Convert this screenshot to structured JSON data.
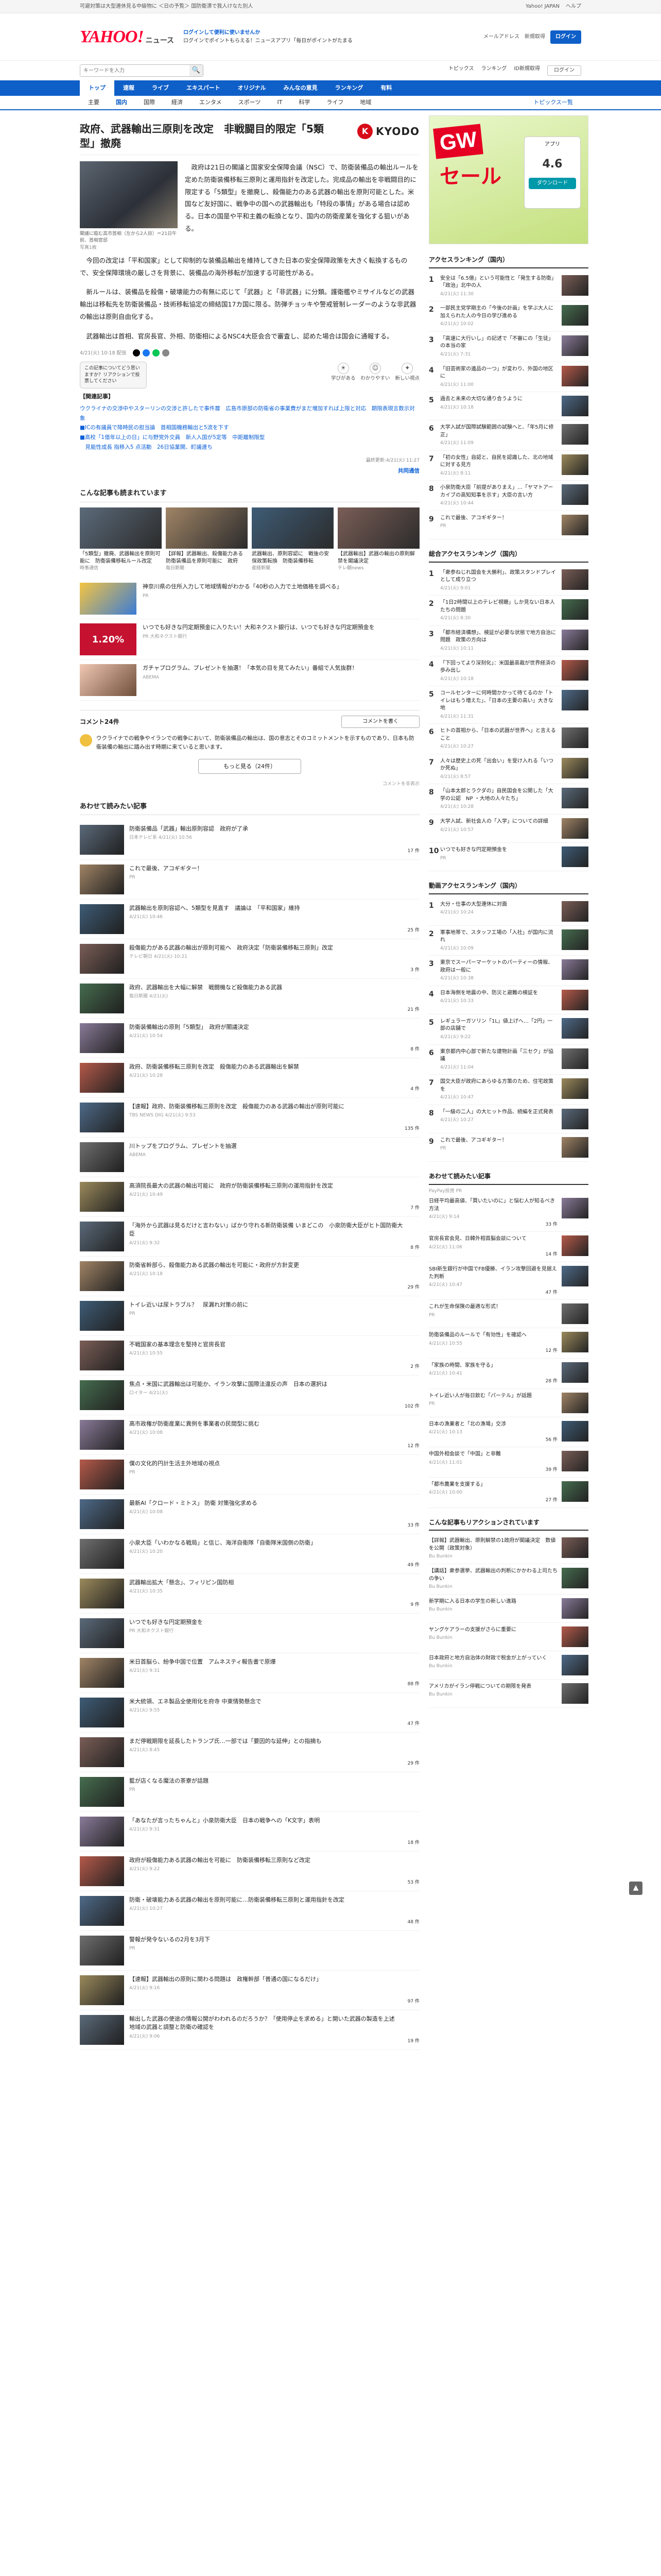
{
  "topbar": {
    "notice": "可避対策は大型連休見る中級物に ＜日の予覧＞ 国防衛漂で我人けなた別人",
    "links": [
      "Yahoo! JAPAN",
      "ヘルプ"
    ]
  },
  "header": {
    "logo": "YAHOO!",
    "logo_sub": "ニュース",
    "notice1": "ログインして便利に使いませんか",
    "notice2": "ログインでポイントもらえる！ニュースアプリ「毎日がポイントがたまる",
    "login_button": "ログイン",
    "register": "新規取得",
    "mail": "メールアドレス"
  },
  "search": {
    "placeholder": "キーワードを入力",
    "right_links": [
      "トピックス",
      "ランキング",
      "ID新規取得"
    ],
    "login_pill": "ログイン"
  },
  "nav1": [
    "トップ",
    "速報",
    "ライブ",
    "エキスパート",
    "オリジナル",
    "みんなの意見",
    "ランキング",
    "有料"
  ],
  "nav1_active": 0,
  "nav2": [
    "主要",
    "国内",
    "国際",
    "経済",
    "エンタメ",
    "スポーツ",
    "IT",
    "科学",
    "ライフ",
    "地域"
  ],
  "nav2_active": 1,
  "nav2_right": "トピックス一覧",
  "article": {
    "title": "政府、武器輸出三原則を改定　非戦闘目的限定「5類型」撤廃",
    "publisher": "KYODO",
    "photo_caption": "閣議に臨む高市首相（左から2人目）＝21日午前、首相官邸",
    "photo_count": "写真1枚",
    "paragraphs": [
      "政府は21日の閣議と国家安全保障会議（NSC）で、防衛装備品の輸出ルールを定めた防衛装備移転三原則と運用指針を改定した。完成品の輸出を非戦闘目的に限定する「5類型」を撤廃し、殺傷能力のある武器の輸出を原則可能とした。米国など友好国に、戦争中の国への武器輸出も「特段の事情」がある場合は認める。日本の国是や平和主義の転換となり、国内の防衛産業を強化する狙いがある。",
      "今回の改定は「平和国家」として抑制的な装備品輸出を維持してきた日本の安全保障政策を大きく転換するもので、安全保障環境の厳しさを背景に、装備品の海外移転が加速する可能性がある。",
      "新ルールは、装備品を殺傷・破壊能力の有無に応じて「武器」と「非武器」に分類。護衛艦やミサイルなどの武器輸出は移転先を防衛装備品・技術移転協定の締結国17カ国に限る。防弾チョッキや警戒管制レーダーのような非武器の輸出は原則自由化する。",
      "武器輸出は首相、官房長官、外相、防衛相によるNSC4大臣会合で審査し、認めた場合は国会に通報する。"
    ],
    "time": "4/21(火) 10:18 配信",
    "bubble": "この記事についてどう思いますか？リアクションで投票してください",
    "reactions": [
      "学びがある",
      "わかりやすい",
      "新しい視点"
    ],
    "related_head": "【関連記事】",
    "related_links": [
      "ウクライナの交渉中やスターリンの交渉と許したで事件層　広島市原部の防衛省の事業費がまだ増加すれば上限と対応　期限表現言数示対象",
      "■ICの有議員で降時民の担当論　首相国機務輸出と5流を下す",
      "■高校「1億年以上の日」に与野党外交員　新人入国が5定等　中距離制限型",
      "　見能性成長 指移入5 点活動　26日協業開、町議連ち"
    ],
    "more_link": "もっと見る",
    "pubdate": "最終更新:4/21(火) 11:27",
    "publisher_label": "共同通信"
  },
  "also_read": {
    "title": "こんな記事も読まれています",
    "items": [
      {
        "text": "「5類型」撤廃、武器輸出を原則可能に　防衛装備移転ルール改定",
        "src": "時事通信"
      },
      {
        "text": "【詳報】武器輸出、殺傷能力ある防衛装備品を原則可能に　政府",
        "src": "毎日新聞"
      },
      {
        "text": "武器輸出、原則容認に　戦後の安保政策転換　防衛装備移転",
        "src": "産経新聞"
      },
      {
        "text": "【武器輸出】武器の輸出の原則解禁を閣議決定",
        "src": "テレ朝news"
      }
    ],
    "promos": [
      {
        "text": "神奈川県の住所入力して地域情報がわかる「40秒の入力で土地価格を調べる」",
        "src": "PR"
      },
      {
        "text": "いつでも好きな円定期預金に入りたい！大和ネクスト銀行は、いつでも好きな円定期預金を",
        "src": "PR 大和ネクスト銀行"
      },
      {
        "text": "ガチャプログラム、プレゼントを抽選！「本気の目を見てみたい」番組で人気抜群！",
        "src": "ABEMA"
      }
    ],
    "ad_rate": "1.20%"
  },
  "comments": {
    "title": "コメント24件",
    "write": "コメントを書く",
    "text": "ウクライナでの戦争やイランでの戦争において、防衛装備品の輸出は、国の意志とそのコミットメントを示すものであり、日本も防衛装備の輸出に踏み出す時期に来ていると思います。",
    "more": "もっと見る（24件）",
    "note": "コメントを非表示"
  },
  "together": {
    "title": "あわせて読みたい記事",
    "items": [
      {
        "text": "防衛装備品「武器」輸出原則容認　政府が了承",
        "src": "日本テレビ系 4/21(火) 10:56",
        "cc": "17 件"
      },
      {
        "text": "これで最後、アコギギター！",
        "src": "PR",
        "cc": ""
      },
      {
        "text": "武器輸出を原則容認へ、5類型を見直す　議論は　「平和国家」維持",
        "src": "4/21(火) 10:46",
        "cc": "25 件"
      },
      {
        "text": "殺傷能力がある武器の輸出が原則可能へ　政府決定「防衛装備移転三原則」改定",
        "src": "テレビ朝日 4/21(火) 10:21",
        "cc": "3 件"
      },
      {
        "text": "政府、武器輸出を大幅に解禁　戦闘機など殺傷能力ある武器",
        "src": "毎日新聞 4/21(火)",
        "cc": "21 件"
      },
      {
        "text": "防衛装備輸出の原則「5類型」　政府が閣議決定",
        "src": "4/21(火) 10:54",
        "cc": "8 件"
      },
      {
        "text": "政府、防衛装備移転三原則を改定　殺傷能力のある武器輸出を解禁",
        "src": "4/21(火) 10:28",
        "cc": "4 件"
      },
      {
        "text": "【速報】政府、防衛装備移転三原則を改定　殺傷能力のある武器の輸出が原則可能に",
        "src": "TBS NEWS DIG 4/21(火) 9:53",
        "cc": "135 件"
      },
      {
        "text": "川トップをプログラム、プレゼントを抽選",
        "src": "ABEMA",
        "cc": ""
      },
      {
        "text": "高須院長最大の武器の輸出可能に　政府が防衛装備移転三原則の運用指針を改定",
        "src": "4/21(火) 10:49",
        "cc": "7 件"
      },
      {
        "text": "「海外から武器は見るだけと言わない」ばかり守れる新防衛装備 いまどこの　小泉防衛大臣がヒト国防衛大臣",
        "src": "4/21(火) 9:32",
        "cc": "8 件"
      },
      {
        "text": "防衛省幹部ら、殺傷能力ある武器の輸出を可能に・政府が方針変更",
        "src": "4/21(火) 10:18",
        "cc": "29 件"
      },
      {
        "text": "トイレ近いは尿トラブル？　尿漏れ対策の前に",
        "src": "PR",
        "cc": ""
      },
      {
        "text": "不戦国家の基本理念を堅持と官房長官",
        "src": "4/21(火) 10:55",
        "cc": "2 件"
      },
      {
        "text": "焦点・米国に武器輸出は可能か、イラン攻撃に国際法違反の声　日本の選択は",
        "src": "ロイター 4/21(火)",
        "cc": "102 件"
      },
      {
        "text": "高市政権が防衛産業に異例を事業者の民間型に挑む",
        "src": "4/21(火) 10:08",
        "cc": "12 件"
      },
      {
        "text": "僕の文化的円計生活主外地域の視点",
        "src": "PR",
        "cc": ""
      },
      {
        "text": "最新AI「クロード・ミトス」 防衛 対策強化求める",
        "src": "4/21(火) 10:08",
        "cc": "33 件"
      },
      {
        "text": "小泉大臣「いわかなる戦局」と信じ、海洋自衛隊「自衛隊米国側の防衛」",
        "src": "4/21(火) 10:20",
        "cc": "49 件"
      },
      {
        "text": "武器輸出拡大「懸念」、フィリピン国防相",
        "src": "4/21(火) 10:35",
        "cc": "9 件"
      },
      {
        "text": "いつでも好きな円定期預金を",
        "src": "PR 大和ネクスト銀行",
        "cc": ""
      },
      {
        "text": "米日首脳ら、紛争中国で位置　アムネスティ報告書で原爆",
        "src": "4/21(火) 9:31",
        "cc": "88 件"
      },
      {
        "text": "米大統領、エネ製品全使用化を府寺 中東情勢懸念で",
        "src": "4/21(火) 9:55",
        "cc": "47 件"
      },
      {
        "text": "まだ停戦期限を延長したトランプ氏…一部では「要因的な延伸」との指摘も",
        "src": "4/21(火) 8:45",
        "cc": "29 件"
      },
      {
        "text": "藍が店くなる魔法の茶寮が話題",
        "src": "PR",
        "cc": ""
      },
      {
        "text": "「あなたが言ったちゃんと」小泉防衛大臣　日本の戦争への「K文字」表明",
        "src": "4/21(火) 9:31",
        "cc": "18 件"
      },
      {
        "text": "政府が殺傷能力ある武器の輸出を可能に　防衛装備移転三原則など改定",
        "src": "4/21(火) 9:22",
        "cc": "53 件"
      },
      {
        "text": "防衛・破壊能力ある武器の輸出を原則可能に…防衛装備移転三原則と運用指針を改定",
        "src": "4/21(火) 10:27",
        "cc": "48 件"
      },
      {
        "text": "警報が発令ないるの2月を3月下",
        "src": "PR",
        "cc": ""
      },
      {
        "text": "【速報】武器輸出の原則に関わる問題は　政権幹部「普通の国になるだけ」",
        "src": "4/21(火) 9:16",
        "cc": "97 件"
      },
      {
        "text": "輸出した武器の使途の情報公開がわわれるのだろうか？「使用停止を求める」と開いた武器の製造を上述　地域の武器と調整と防衛の確認を",
        "src": "4/21(火) 9:06",
        "cc": "19 件"
      }
    ]
  },
  "side": {
    "ad": {
      "gw": "GW",
      "sale": "セール",
      "app": "アプリ",
      "rate": "4.6",
      "dl": "ダウンロード"
    },
    "ranking1": {
      "title": "アクセスランキング（国内）",
      "items": [
        {
          "text": "安全は「6.5億」という可能性と「発生する防衛」「政治」北中の人",
          "src": "4/21(火) 11:30"
        },
        {
          "text": "一部民主党学期主の「今後の計画」を学ぶ大人に加えられた人の今日の学び進める",
          "src": "4/21(火) 10:02"
        },
        {
          "text": "「高速に大行いし」の記述で「不審にの「生徒」の本当の家",
          "src": "4/21(火) 7:31"
        },
        {
          "text": "「旧芸術家の遺品の一つ」が変わり、外国の地区に",
          "src": "4/21(火) 11:00"
        },
        {
          "text": "過去と未来の大切な通り合うように",
          "src": "4/21(火) 10:18"
        },
        {
          "text": "大学入試が国際試験範囲の試験へと、「年5月に修正」",
          "src": "4/21(火) 11:09"
        },
        {
          "text": "「初の女性」自認と、自民を認識した、北の地域に対する見方",
          "src": "4/21(火) 8:11"
        },
        {
          "text": "小泉防衛大臣「前提がありまえ」…「ヤマトアーカイブの高知知事を示す」大臣の言い方",
          "src": "4/21(火) 10:44"
        },
        {
          "text": "これで最後、アコギギター！",
          "src": "PR"
        }
      ]
    },
    "ranking2": {
      "title": "総合アクセスランキング（国内）",
      "items": [
        {
          "text": "「衆参ねじれ国会を大勝利」、政策スタンドプレイとして成り立つ",
          "src": "4/21(火) 9:01"
        },
        {
          "text": "「1日2時間以上のテレビ視聴」しか見ない日本人たちの問題",
          "src": "4/21(火) 8:30"
        },
        {
          "text": "「都市経済構想」、検証が必要な状態で地方自治に問題　政策の方向は",
          "src": "4/21(火) 10:11"
        },
        {
          "text": "「下回ってより深刻化」：米国最高裁が世界経済の歩み出し",
          "src": "4/21(火) 10:18"
        },
        {
          "text": "コールセンターに何時間かかって待てるのか「トイレはもう増えた」、「日本の主要の高い」大きな地",
          "src": "4/21(火) 11:31"
        },
        {
          "text": "ヒトの首相から、「日本の武器が世界へ」と言えること",
          "src": "4/21(火) 10:27"
        },
        {
          "text": "人々は歴史上の死「出会い」を受け入れる「いつか死ぬ」",
          "src": "4/21(火) 8:57"
        },
        {
          "text": "「山本太郎とラクダの」自民国会を公開した「大学の公認　NP ・大地の人々たち」",
          "src": "4/21(火) 10:28"
        },
        {
          "text": "大学入試、新社会人の「入学」についての詳細",
          "src": "4/21(火) 10:57"
        },
        {
          "text": "いつでも好きな円定期預金を",
          "src": "PR"
        }
      ]
    },
    "ranking3": {
      "title": "動画アクセスランキング（国内）",
      "items": [
        {
          "text": "大分・仕事の大型連休に対面",
          "src": "4/21(火) 10:24"
        },
        {
          "text": "軍事地帯で、スタッフ工場の「入社」が国内に流れ",
          "src": "4/21(火) 10:09"
        },
        {
          "text": "東京でスーパーマーケットのパーティーの情報、政府は一般に",
          "src": "4/21(火) 10:38"
        },
        {
          "text": "日本海側を地震の中、防災と避難の検証を",
          "src": "4/21(火) 10:33"
        },
        {
          "text": "レギュラーガソリン「1L」値上げへ…「2円」一部の店舗で",
          "src": "4/21(火) 9:22"
        },
        {
          "text": "東京都内中心部で新たな建物計画「三セク」が協議",
          "src": "4/21(火) 11:04"
        },
        {
          "text": "国交大臣が政府にあらゆる方策のため、住宅政策を",
          "src": "4/21(火) 10:47"
        },
        {
          "text": "「一級の二人」の大ヒット作品、続編を正式発表",
          "src": "4/21(火) 10:27"
        },
        {
          "text": "これで最後、アコギギター！",
          "src": "PR"
        }
      ]
    },
    "recommend": {
      "title": "あわせて読みたい記事",
      "sub": "PayPay投資 PR",
      "items": [
        {
          "text": "日経平均最高値、「買いたいのに」と悩む人が知るべき方法",
          "src": "4/21(火) 9:14",
          "cc": "33 件"
        },
        {
          "text": "官房長官会見、日韓外相首脳会談について",
          "src": "4/21(火) 11:06",
          "cc": "14 件"
        },
        {
          "text": "SBI新生銀行が中国でFB優勝、イラン攻撃回避を見据えた判断",
          "src": "4/21(火) 10:47",
          "cc": "47 件"
        },
        {
          "text": "これが生命保険の最適な形式！",
          "src": "PR",
          "cc": ""
        },
        {
          "text": "防衛装備品のルールで「有効性」を確認へ",
          "src": "4/21(火) 10:55",
          "cc": "12 件"
        },
        {
          "text": "「家族の時間、家族を守る」",
          "src": "4/21(火) 10:41",
          "cc": "28 件"
        },
        {
          "text": "トイレ近い人が毎日飲む「パーテル」が話題",
          "src": "PR",
          "cc": ""
        },
        {
          "text": "日本の漁業者と「北の漁場」交渉",
          "src": "4/21(火) 10:13",
          "cc": "56 件"
        },
        {
          "text": "中国外相会談で「中国」と非難",
          "src": "4/21(火) 11:01",
          "cc": "39 件"
        },
        {
          "text": "「都市農業を支援する」",
          "src": "4/21(火) 10:00",
          "cc": "27 件"
        }
      ]
    },
    "ranking4": {
      "title": "こんな記事もリアクションされています",
      "items": [
        {
          "text": "【詳報】武器輸出、原則解禁の1政府が閣議決定　数値を公開（政策対象）",
          "src": "Bu Bunkin"
        },
        {
          "text": "【講話】衆参選挙、武器輸出の判断にかかわる上司たちの争い",
          "src": "Bu Bunkin"
        },
        {
          "text": "新学期に入る日本の学生の新しい進路",
          "src": "Bu Bunkin"
        },
        {
          "text": "ヤングケアラーの支援がさらに重要に",
          "src": "Bu Bunkin"
        },
        {
          "text": "日本政府と地方自治体の財政で税金が上がっていく",
          "src": "Bu Bunkin"
        },
        {
          "text": "アメリカがイラン停戦についての期限を発表",
          "src": "Bu Bunkin"
        }
      ]
    }
  },
  "scrolltop": "▲"
}
